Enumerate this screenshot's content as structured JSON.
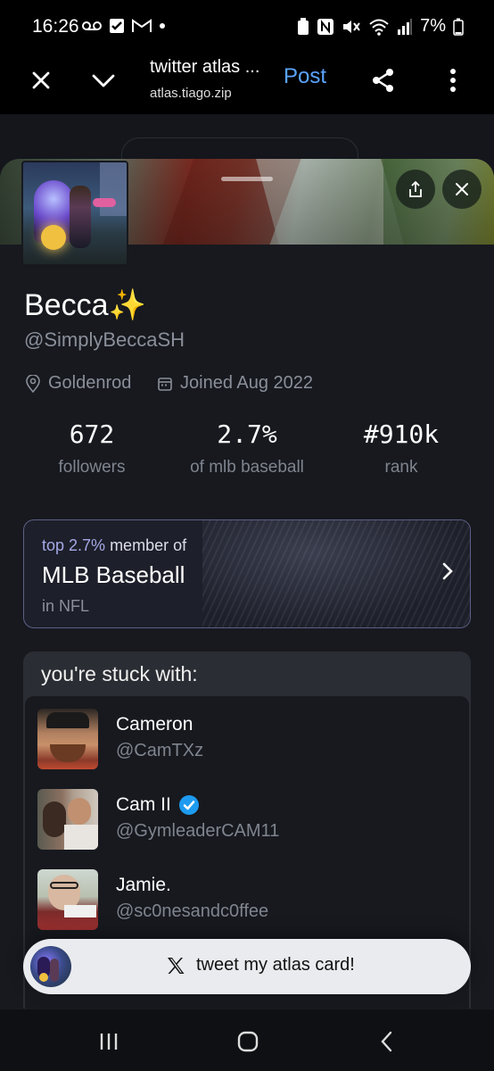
{
  "status_bar": {
    "time": "16:26",
    "battery": "7%",
    "icons_left": [
      "voicemail-icon",
      "check-box-icon",
      "gmail-icon",
      "dot-icon"
    ],
    "icons_right": [
      "battery-saver-icon",
      "nfc-icon",
      "mute-icon",
      "wifi-icon",
      "signal-icon"
    ]
  },
  "browser": {
    "title": "twitter atlas ...",
    "url": "atlas.tiago.zip",
    "post_label": "Post"
  },
  "profile": {
    "name": "Becca✨",
    "handle": "@SimplyBeccaSH",
    "location": "Goldenrod",
    "joined": "Joined Aug 2022"
  },
  "stats": [
    {
      "value": "672",
      "label": "followers"
    },
    {
      "value": "2.7%",
      "label": "of mlb baseball"
    },
    {
      "value": "#910k",
      "label": "rank"
    }
  ],
  "community_card": {
    "highlight": "top 2.7%",
    "prefix_text": " member of",
    "community": "MLB Baseball",
    "parent": "in NFL"
  },
  "stuck_with": {
    "header": "you're stuck with:",
    "people": [
      {
        "name": "Cameron",
        "handle": "@CamTXz",
        "verified": false
      },
      {
        "name": "Cam II",
        "handle": "@GymleaderCAM11",
        "verified": true
      },
      {
        "name": "Jamie.",
        "handle": "@sc0nesandc0ffee",
        "verified": false
      }
    ]
  },
  "tweet_button": {
    "label": "tweet my atlas card!"
  },
  "colors": {
    "accent_link": "#5aa4ff",
    "highlight": "#a5a8e6",
    "verified": "#1d9bf0",
    "card_border": "#5d5f86"
  }
}
